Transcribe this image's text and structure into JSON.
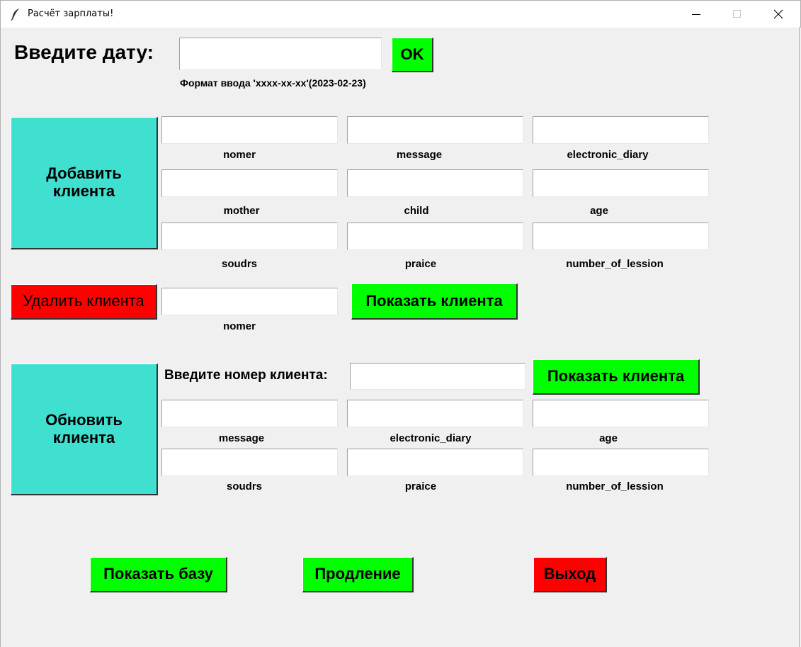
{
  "window": {
    "title": "Расчёт зарплаты!",
    "icons": [
      "feather-icon",
      "minimize-icon",
      "maximize-icon",
      "close-icon"
    ]
  },
  "date": {
    "label": "Введите дату:",
    "value": "",
    "ok_label": "OK",
    "hint": "Формат ввода 'xxxx-xx-xx'(2023-02-23)"
  },
  "add": {
    "button": "Добавить\nклиента",
    "fields": [
      "nomer",
      "message",
      "electronic_diary",
      "mother",
      "child",
      "age",
      "soudrs",
      "praice",
      "number_of_lession"
    ]
  },
  "delete": {
    "button": "Удалить клиента",
    "field": "nomer",
    "show_button": "Показать клиента"
  },
  "update": {
    "button": "Обновить\nклиента",
    "number_label": "Введите номер клиента:",
    "show_button": "Показать клиента",
    "fields": [
      "message",
      "electronic_diary",
      "age",
      "soudrs",
      "praice",
      "number_of_lession"
    ]
  },
  "bottom": {
    "show_db": "Показать базу",
    "extend": "Продление",
    "exit": "Выход"
  },
  "colors": {
    "green": "#00ff00",
    "red": "#ff0000",
    "cyan": "#40e0d0",
    "background": "#f0f0f0"
  }
}
